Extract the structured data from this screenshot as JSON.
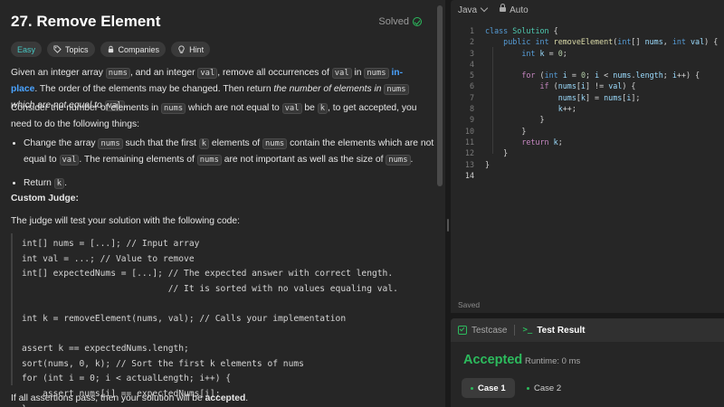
{
  "problem": {
    "title": "27. Remove Element",
    "status": "Solved",
    "tags": [
      {
        "label": "Easy",
        "icon": ""
      },
      {
        "label": "Topics",
        "icon": "tag-icon"
      },
      {
        "label": "Companies",
        "icon": "lock-icon"
      },
      {
        "label": "Hint",
        "icon": "lightbulb-icon"
      }
    ],
    "description": {
      "p1": {
        "a": "Given an integer array ",
        "nums": "nums",
        "b": ", and an integer ",
        "val": "val",
        "c": ", remove all occurrences of ",
        "val2": "val",
        "d": " in ",
        "nums2": "nums",
        "e": " ",
        "inplace": "in-place",
        "f": ". The order of the elements may be changed. Then return ",
        "g": "the number of elements in ",
        "nums3": "nums",
        "h": " which are not equal to ",
        "val3": "val",
        "i": "."
      },
      "p2": {
        "a": "Consider the number of elements in ",
        "nums": "nums",
        "b": " which are not equal to ",
        "val": "val",
        "c": " be ",
        "k": "k",
        "d": ", to get accepted, you need to do the following things:"
      },
      "bullet1": {
        "a": "Change the array ",
        "nums": "nums",
        "b": " such that the first ",
        "k": "k",
        "c": " elements of ",
        "nums2": "nums",
        "d": " contain the elements which are not equal to ",
        "val": "val",
        "e": ". The remaining elements of ",
        "nums3": "nums",
        "f": " are not important as well as the size of ",
        "nums4": "nums",
        "g": "."
      },
      "bullet2": {
        "a": "Return ",
        "k": "k",
        "b": "."
      },
      "custom_judge": "Custom Judge:",
      "judge_text": "The judge will test your solution with the following code:",
      "judge_code": "int[] nums = [...]; // Input array\nint val = ...; // Value to remove\nint[] expectedNums = [...]; // The expected answer with correct length.\n                            // It is sorted with no values equaling val.\n\nint k = removeElement(nums, val); // Calls your implementation\n\nassert k == expectedNums.length;\nsort(nums, 0, k); // Sort the first k elements of nums\nfor (int i = 0; i < actualLength; i++) {\n    assert nums[i] == expectedNums[i];\n}",
      "final": {
        "a": "If all assertions pass, then your solution will be ",
        "b": "accepted",
        "c": "."
      }
    }
  },
  "editor": {
    "language": "Java",
    "mode": "Auto",
    "line_numbers": [
      "1",
      "2",
      "3",
      "4",
      "5",
      "6",
      "7",
      "8",
      "9",
      "10",
      "11",
      "12",
      "13",
      "14"
    ],
    "status": "Saved"
  },
  "result": {
    "tabs": [
      "Testcase",
      "Test Result"
    ],
    "term_glyph": ">_",
    "verdict": "Accepted",
    "runtime": "Runtime: 0 ms",
    "cases": [
      "Case 1",
      "Case 2"
    ]
  },
  "colors": {
    "accent_green": "#2cbb5d",
    "easy": "#46c6c2",
    "link": "#4aa3ff"
  }
}
